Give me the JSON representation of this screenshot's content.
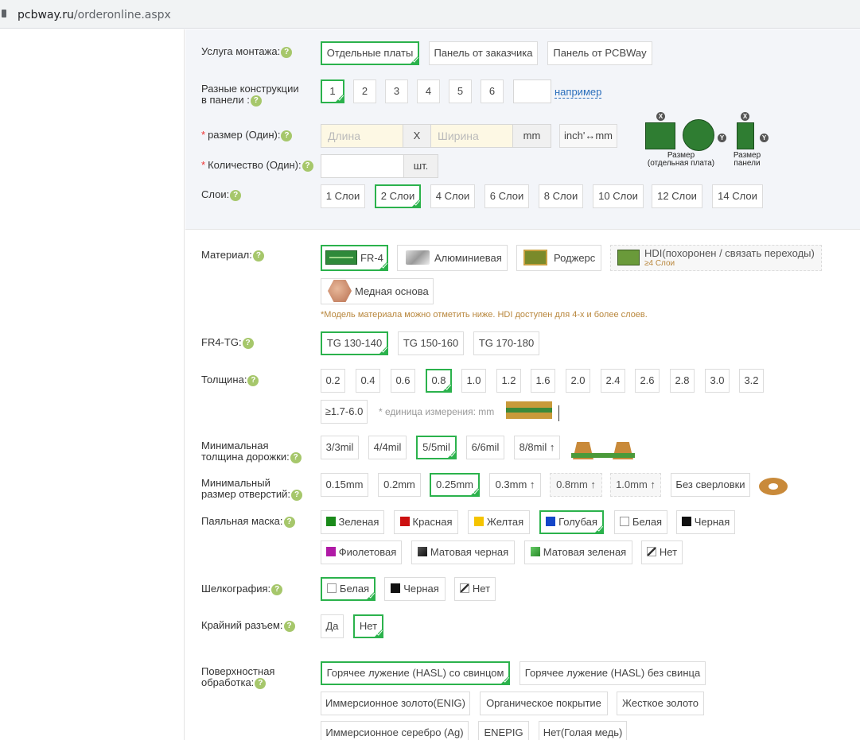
{
  "browser": {
    "host": "pcbway.ru",
    "path": "/orderonline.aspx"
  },
  "labels": {
    "assembly": "Услуга монтажа:",
    "designs_l1": "Разные конструкции",
    "designs_l2": "в панели :",
    "size": "размер (Один):",
    "qty": "Количество (Один):",
    "layers": "Слои:",
    "material": "Материал:",
    "fr4tg": "FR4-TG:",
    "thickness": "Толщина:",
    "track_l1": "Минимальная",
    "track_l2": "толщина дорожки:",
    "hole_l1": "Минимальный",
    "hole_l2": "размер отверстий:",
    "mask": "Паяльная маска:",
    "silk": "Шелкография:",
    "edge": "Крайний разъем:",
    "surface_l1": "Поверхностная",
    "surface_l2": "обработка:"
  },
  "assembly": [
    "Отдельные платы",
    "Панель от заказчика",
    "Панель от PCBWay"
  ],
  "designs": {
    "options": [
      "1",
      "2",
      "3",
      "4",
      "5",
      "6"
    ],
    "example_link": "например"
  },
  "size": {
    "length_placeholder": "Длина",
    "x": "X",
    "width_placeholder": "Ширина",
    "unit": "mm",
    "convert": "inch'↔mm"
  },
  "qty": {
    "unit": "шт."
  },
  "size_images": {
    "single_caption_1": "Размер",
    "single_caption_2": "(отдельная плата)",
    "panel_caption_1": "Размер",
    "panel_caption_2": "панели"
  },
  "layers": [
    "1 Слои",
    "2 Слои",
    "4 Слои",
    "6 Слои",
    "8 Слои",
    "10 Слои",
    "12 Слои",
    "14 Слои"
  ],
  "material": {
    "options": [
      "FR-4",
      "Алюминиевая",
      "Роджерс",
      "HDI(похоронен / связать переходы)",
      "Медная основа"
    ],
    "hdi_sub": "≥4 Слои",
    "note": "*Модель материала можно отметить ниже. HDI доступен для 4-х и более слоев."
  },
  "fr4tg": [
    "TG 130-140",
    "TG 150-160",
    "TG 170-180"
  ],
  "thickness": {
    "options": [
      "0.2",
      "0.4",
      "0.6",
      "0.8",
      "1.0",
      "1.2",
      "1.6",
      "2.0",
      "2.4",
      "2.6",
      "2.8",
      "3.0",
      "3.2"
    ],
    "extra": "≥1.7-6.0",
    "unit_note": "* единица измерения: mm"
  },
  "track": [
    "3/3mil",
    "4/4mil",
    "5/5mil",
    "6/6mil",
    "8/8mil ↑"
  ],
  "hole": [
    "0.15mm",
    "0.2mm",
    "0.25mm",
    "0.3mm ↑",
    "0.8mm ↑",
    "1.0mm ↑",
    "Без сверловки"
  ],
  "mask": [
    "Зеленая",
    "Красная",
    "Желтая",
    "Голубая",
    "Белая",
    "Черная",
    "Фиолетовая",
    "Матовая черная",
    "Матовая зеленая",
    "Нет"
  ],
  "silk": [
    "Белая",
    "Черная",
    "Нет"
  ],
  "edge": [
    "Да",
    "Нет"
  ],
  "surface": [
    "Горячее лужение (HASL) со свинцом",
    "Горячее лужение (HASL) без свинца",
    "Иммерсионное золото(ENIG)",
    "Органическое покрытие",
    "Жесткое золото",
    "Иммерсионное серебро (Ag)",
    "ENEPIG",
    "Нет(Голая медь)"
  ],
  "colors": {
    "accent": "#2bb24c",
    "mask_green": "#1a8a1a",
    "mask_red": "#cc1111",
    "mask_yellow": "#f5c400",
    "mask_blue": "#1446c8",
    "mask_black": "#111111",
    "mask_purple": "#b01aa6",
    "mask_matte_black": "#333333",
    "mask_matte_green": "#3aa33a"
  }
}
